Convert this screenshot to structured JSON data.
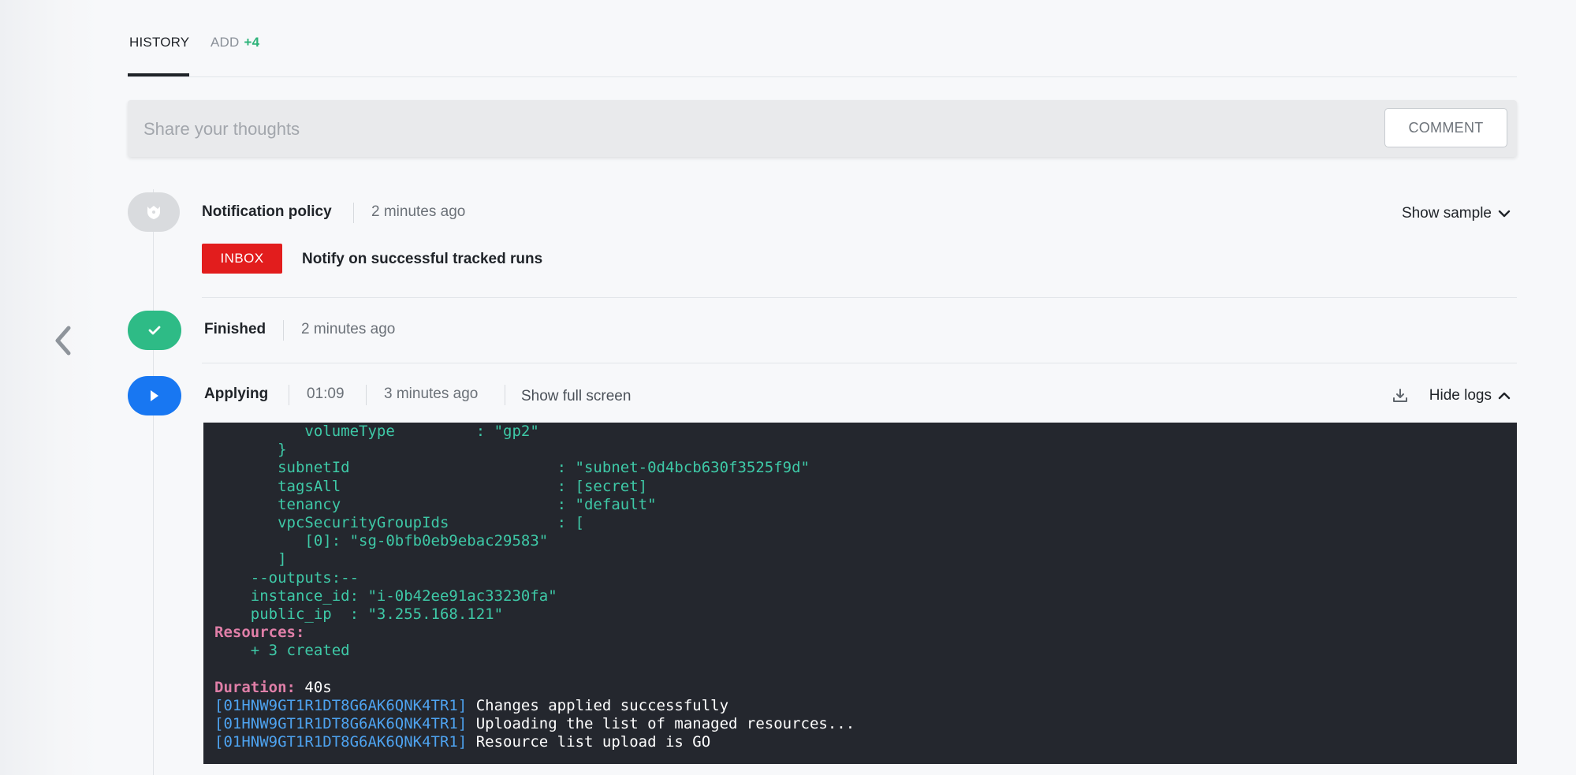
{
  "tabs": {
    "history_label": "HISTORY",
    "add_label": "ADD",
    "add_count": "+4"
  },
  "comment": {
    "placeholder": "Share your thoughts",
    "button_label": "COMMENT"
  },
  "events": {
    "policy": {
      "title": "Notification policy",
      "time": "2 minutes ago",
      "show_sample_label": "Show sample",
      "badge": "INBOX",
      "description": "Notify on successful tracked runs"
    },
    "finished": {
      "title": "Finished",
      "time": "2 minutes ago"
    },
    "applying": {
      "title": "Applying",
      "duration": "01:09",
      "time": "3 minutes ago",
      "fullscreen_label": "Show full screen",
      "hide_logs_label": "Hide logs"
    }
  },
  "logs": [
    {
      "segments": [
        {
          "text": "          volumeType         : \"gp2\"",
          "color": "green"
        }
      ]
    },
    {
      "segments": [
        {
          "text": "       }",
          "color": "green"
        }
      ]
    },
    {
      "segments": [
        {
          "text": "       subnetId                       : \"subnet-0d4bcb630f3525f9d\"",
          "color": "green"
        }
      ]
    },
    {
      "segments": [
        {
          "text": "       tagsAll                        : [secret]",
          "color": "green"
        }
      ]
    },
    {
      "segments": [
        {
          "text": "       tenancy                        : \"default\"",
          "color": "green"
        }
      ]
    },
    {
      "segments": [
        {
          "text": "       vpcSecurityGroupIds            : [",
          "color": "green"
        }
      ]
    },
    {
      "segments": [
        {
          "text": "          [0]: \"sg-0bfb0eb9ebac29583\"",
          "color": "green"
        }
      ]
    },
    {
      "segments": [
        {
          "text": "       ]",
          "color": "green"
        }
      ]
    },
    {
      "segments": [
        {
          "text": "    --outputs:--",
          "color": "green"
        }
      ]
    },
    {
      "segments": [
        {
          "text": "    instance_id: \"i-0b42ee91ac33230fa\"",
          "color": "green"
        }
      ]
    },
    {
      "segments": [
        {
          "text": "    public_ip  : \"3.255.168.121\"",
          "color": "green"
        }
      ]
    },
    {
      "segments": [
        {
          "text": "Resources:",
          "color": "pink"
        }
      ]
    },
    {
      "segments": [
        {
          "text": "    + 3 created",
          "color": "green"
        }
      ]
    },
    {
      "segments": [
        {
          "text": "",
          "color": "white"
        }
      ]
    },
    {
      "segments": [
        {
          "text": "Duration: ",
          "color": "pink"
        },
        {
          "text": "40s",
          "color": "white"
        }
      ]
    },
    {
      "segments": [
        {
          "text": "[01HNW9GT1R1DT8G6AK6QNK4TR1]",
          "color": "blue"
        },
        {
          "text": " Changes applied successfully",
          "color": "white"
        }
      ]
    },
    {
      "segments": [
        {
          "text": "[01HNW9GT1R1DT8G6AK6QNK4TR1]",
          "color": "blue"
        },
        {
          "text": " Uploading the list of managed resources...",
          "color": "white"
        }
      ]
    },
    {
      "segments": [
        {
          "text": "[01HNW9GT1R1DT8G6AK6QNK4TR1]",
          "color": "blue"
        },
        {
          "text": " Resource list upload is GO",
          "color": "white"
        }
      ]
    }
  ],
  "colors": {
    "accent_green": "#2ebb86",
    "accent_blue": "#1877f2",
    "badge_red": "#e21d1d",
    "log_background": "#24272e"
  }
}
